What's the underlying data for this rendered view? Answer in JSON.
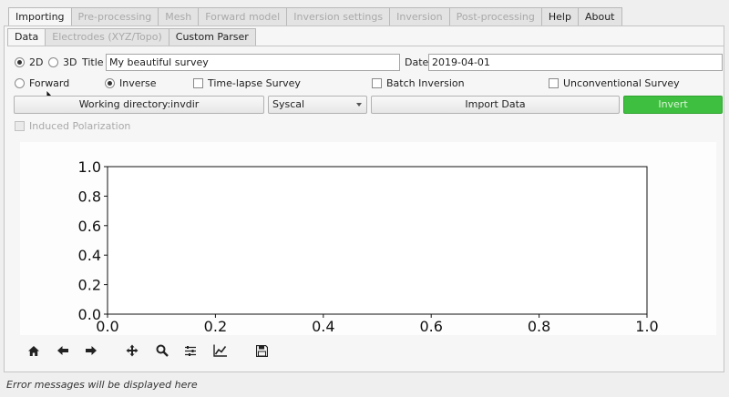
{
  "main_tabs": [
    {
      "label": "Importing",
      "active": true,
      "enabled": true
    },
    {
      "label": "Pre-processing",
      "active": false,
      "enabled": false
    },
    {
      "label": "Mesh",
      "active": false,
      "enabled": false
    },
    {
      "label": "Forward model",
      "active": false,
      "enabled": false
    },
    {
      "label": "Inversion settings",
      "active": false,
      "enabled": false
    },
    {
      "label": "Inversion",
      "active": false,
      "enabled": false
    },
    {
      "label": "Post-processing",
      "active": false,
      "enabled": false
    },
    {
      "label": "Help",
      "active": false,
      "enabled": true
    },
    {
      "label": "About",
      "active": false,
      "enabled": true
    }
  ],
  "sub_tabs": [
    {
      "label": "Data",
      "active": true,
      "enabled": true
    },
    {
      "label": "Electrodes (XYZ/Topo)",
      "active": false,
      "enabled": false
    },
    {
      "label": "Custom Parser",
      "active": false,
      "enabled": true
    }
  ],
  "dimension": {
    "opt_2d": "2D",
    "opt_3d": "3D",
    "selected": "2D"
  },
  "title": {
    "label": "Title",
    "value": "My beautiful survey"
  },
  "date": {
    "label": "Date",
    "value": "2019-04-01"
  },
  "mode": {
    "forward": "Forward",
    "inverse": "Inverse",
    "selected": "Inverse"
  },
  "options": {
    "time_lapse": "Time-lapse Survey",
    "batch": "Batch Inversion",
    "unconventional": "Unconventional Survey",
    "induced_polarization": "Induced Polarization"
  },
  "buttons": {
    "working_dir": "Working directory:invdir",
    "import_data": "Import Data",
    "invert": "Invert"
  },
  "format_select": {
    "value": "Syscal"
  },
  "plot": {
    "y_ticks": [
      "0.0",
      "0.2",
      "0.4",
      "0.6",
      "0.8",
      "1.0"
    ],
    "x_ticks": [
      "0.0",
      "0.2",
      "0.4",
      "0.6",
      "0.8",
      "1.0"
    ]
  },
  "toolbar_icons": [
    "home-icon",
    "back-arrow-icon",
    "forward-arrow-icon",
    "pan-icon",
    "zoom-icon",
    "configure-subplots-icon",
    "edit-axis-icon",
    "save-icon"
  ],
  "status": "Error messages will be displayed here",
  "colors": {
    "invert_button": "#3fbf3f",
    "panel": "#f6f6f6",
    "window": "#efefef"
  }
}
